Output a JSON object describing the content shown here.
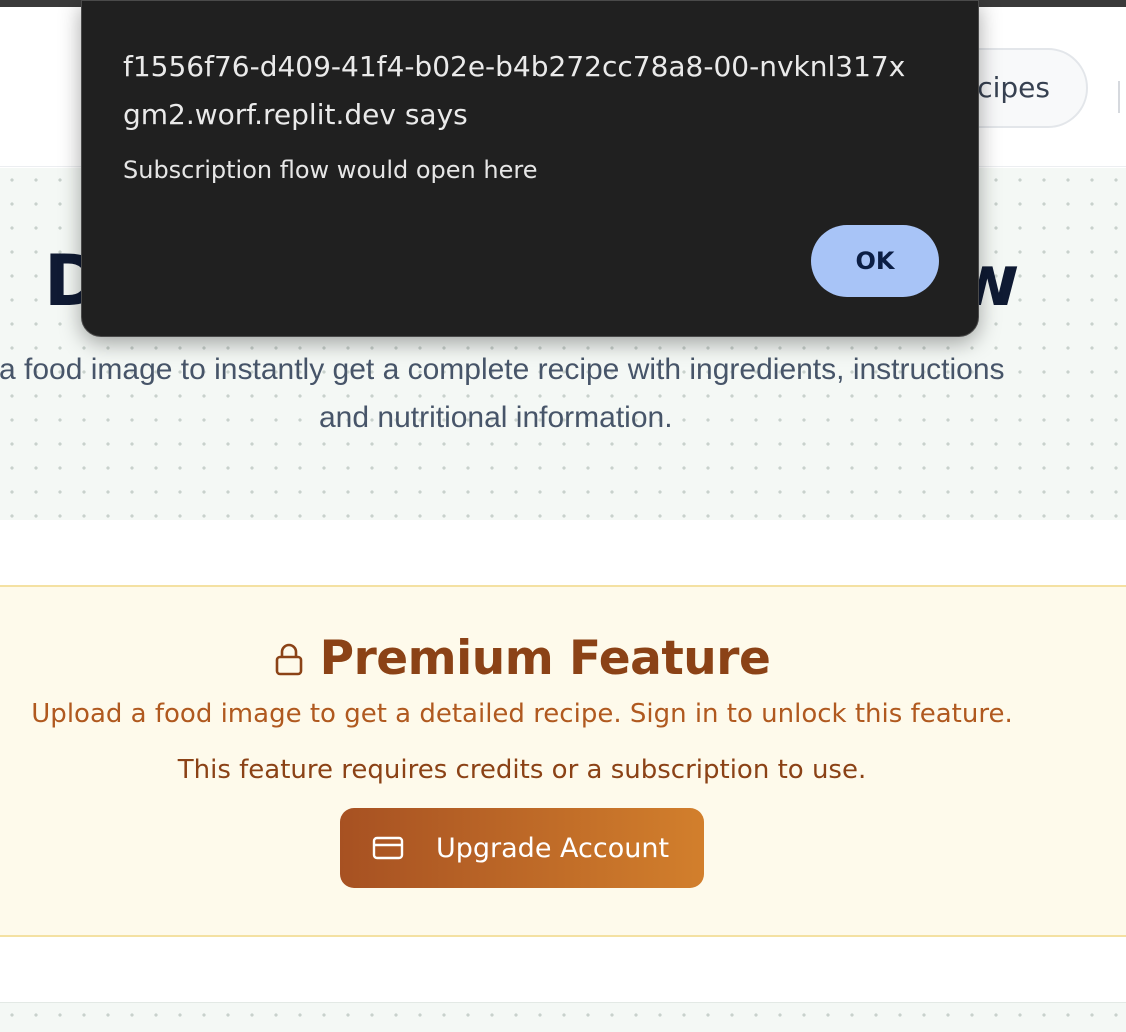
{
  "header": {
    "nav_pill_label": "ecipes"
  },
  "hero": {
    "title_start": "D",
    "title_end": "w",
    "subtitle_line1": "a food image to instantly get a complete recipe with ingredients, instructions",
    "subtitle_line2": "and nutritional information."
  },
  "premium": {
    "title": "Premium Feature",
    "description": "Upload a food image to get a detailed recipe. Sign in to unlock this feature.",
    "note": "This feature requires credits or a subscription to use.",
    "button_label": "Upgrade Account",
    "lock_icon": "lock-icon",
    "card_icon": "credit-card-icon"
  },
  "dialog": {
    "title": "f1556f76-d409-41f4-b02e-b4b272cc78a8-00-nvknl317xgm2.worf.replit.dev says",
    "message": "Subscription flow would open here",
    "ok_label": "OK"
  },
  "colors": {
    "premium_title": "#8b4216",
    "premium_description": "#b0591f",
    "premium_background": "#fefaeb",
    "upgrade_gradient_start": "#a75122",
    "upgrade_gradient_end": "#d27f2c",
    "dialog_background": "#202020",
    "ok_button": "#a8c4f7",
    "hero_background": "#f4f8f5"
  }
}
